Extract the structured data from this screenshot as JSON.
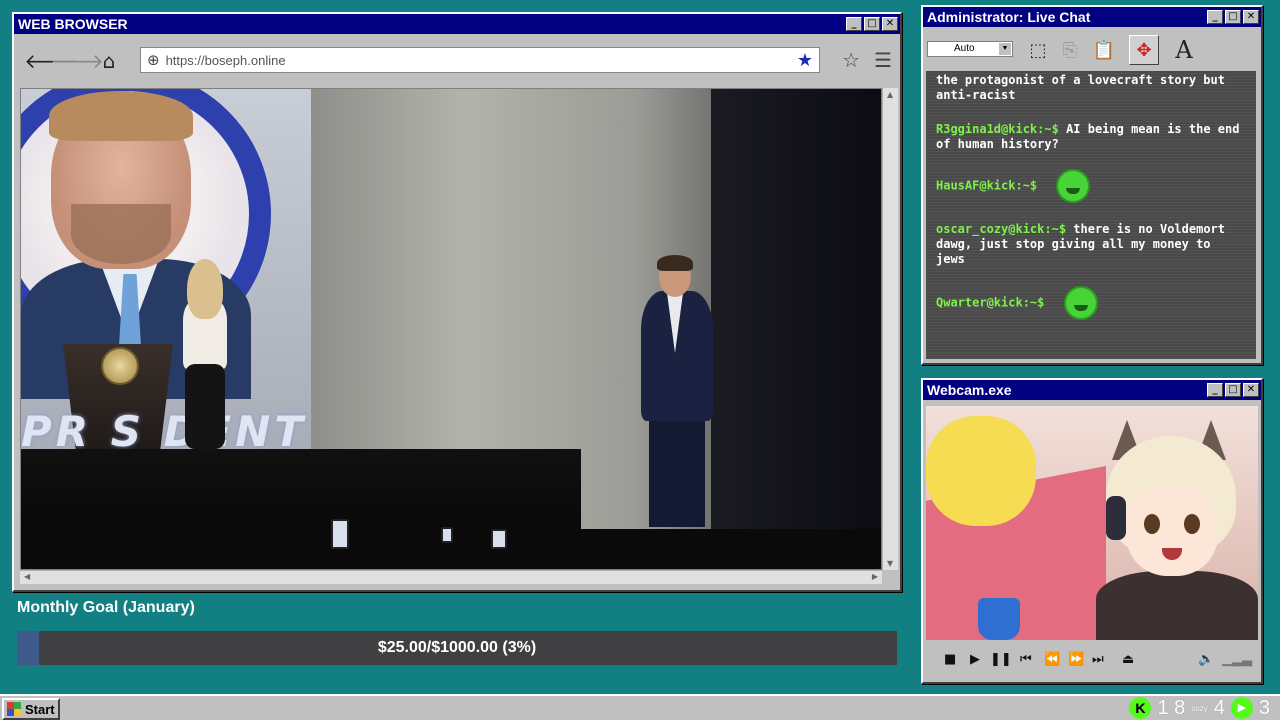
{
  "browser": {
    "title": "WEB BROWSER",
    "url": "https://boseph.online",
    "video_sign_text": "PR S DENT"
  },
  "goal": {
    "label": "Monthly Goal (January)",
    "current": 25.0,
    "target": 1000.0,
    "percent": 3,
    "text": "$25.00/$1000.00 (3%)"
  },
  "chat": {
    "title": "Administrator: Live Chat",
    "select_value": "Auto",
    "messages": [
      {
        "user": "",
        "text": "the protagonist of a lovecraft story but anti-racist",
        "emote": false
      },
      {
        "user": "R3ggina1d@kick:~$",
        "text": "AI being mean is the end of human history?",
        "emote": false
      },
      {
        "user": "HausAF@kick:~$",
        "text": "",
        "emote": true
      },
      {
        "user": "oscar_cozy@kick:~$",
        "text": "there is no Voldemort dawg, just stop giving all my money to jews",
        "emote": false
      },
      {
        "user": "Qwarter@kick:~$",
        "text": "",
        "emote": true
      }
    ]
  },
  "webcam": {
    "title": "Webcam.exe"
  },
  "taskbar": {
    "start_label": "Start",
    "tray_count_1": "1 8",
    "tray_small": "cozy",
    "tray_count_2": "4",
    "tray_count_3": "3"
  },
  "colors": {
    "desktop": "#128082",
    "titlebar": "#000080",
    "chat_user": "#7ef14a",
    "kick_green": "#53fc18",
    "goal_fill": "#3d5a8a"
  }
}
